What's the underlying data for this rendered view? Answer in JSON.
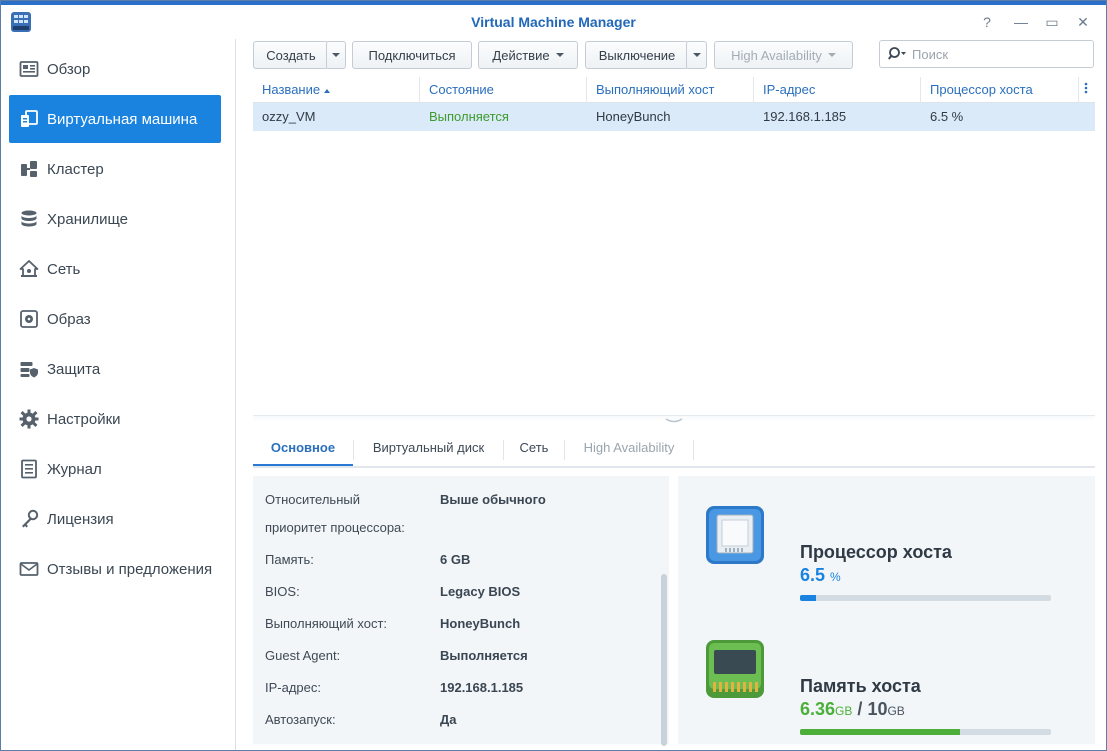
{
  "window": {
    "title": "Virtual Machine Manager",
    "help_glyph": "?",
    "minimize_glyph": "—",
    "maximize_glyph": "▭",
    "close_glyph": "✕"
  },
  "sidebar": {
    "items": [
      {
        "label": "Обзор",
        "icon": "overview-icon",
        "active": false
      },
      {
        "label": "Виртуальная машина",
        "icon": "virtual-machine-icon",
        "active": true
      },
      {
        "label": "Кластер",
        "icon": "cluster-icon",
        "active": false
      },
      {
        "label": "Хранилище",
        "icon": "storage-icon",
        "active": false
      },
      {
        "label": "Сеть",
        "icon": "network-icon",
        "active": false
      },
      {
        "label": "Образ",
        "icon": "image-icon",
        "active": false
      },
      {
        "label": "Защита",
        "icon": "protection-icon",
        "active": false
      },
      {
        "label": "Настройки",
        "icon": "settings-icon",
        "active": false
      },
      {
        "label": "Журнал",
        "icon": "log-icon",
        "active": false
      },
      {
        "label": "Лицензия",
        "icon": "license-icon",
        "active": false
      },
      {
        "label": "Отзывы и предложения",
        "icon": "feedback-icon",
        "active": false
      }
    ]
  },
  "toolbar": {
    "create_label": "Создать",
    "connect_label": "Подключиться",
    "action_label": "Действие",
    "shutdown_label": "Выключение",
    "ha_label": "High Availability",
    "search_placeholder": "Поиск"
  },
  "grid": {
    "columns": [
      "Название",
      "Состояние",
      "Выполняющий хост",
      "IP-адрес",
      "Процессор хоста"
    ],
    "sort_column": "Название",
    "rows": [
      {
        "name": "ozzy_VM",
        "state": "Выполняется",
        "host": "HoneyBunch",
        "ip": "192.168.1.185",
        "cpu": "6.5 %"
      }
    ]
  },
  "tabs": [
    {
      "label": "Основное",
      "active": true,
      "disabled": false
    },
    {
      "label": "Виртуальный диск",
      "active": false,
      "disabled": false
    },
    {
      "label": "Сеть",
      "active": false,
      "disabled": false
    },
    {
      "label": "High Availability",
      "active": false,
      "disabled": true
    }
  ],
  "details": [
    {
      "label": "Относительный",
      "value": "Выше обычного"
    },
    {
      "label": "приоритет процессора:",
      "value": ""
    },
    {
      "label": "Память:",
      "value": "6 GB"
    },
    {
      "label": "BIOS:",
      "value": "Legacy BIOS"
    },
    {
      "label": "Выполняющий хост:",
      "value": "HoneyBunch"
    },
    {
      "label": "Guest Agent:",
      "value": "Выполняется"
    },
    {
      "label": "IP-адрес:",
      "value": "192.168.1.185"
    },
    {
      "label": "Автозапуск:",
      "value": "Да"
    }
  ],
  "resources": {
    "cpu": {
      "title": "Процессор хоста",
      "value": "6.5",
      "unit": "%",
      "percent": 6.5,
      "color": "#1a83e0"
    },
    "memory": {
      "title": "Память хоста",
      "used": "6.36",
      "used_unit": "GB",
      "separator": "/",
      "total": "10",
      "total_unit": "GB",
      "percent": 63.6,
      "color": "#4caf3a"
    }
  }
}
